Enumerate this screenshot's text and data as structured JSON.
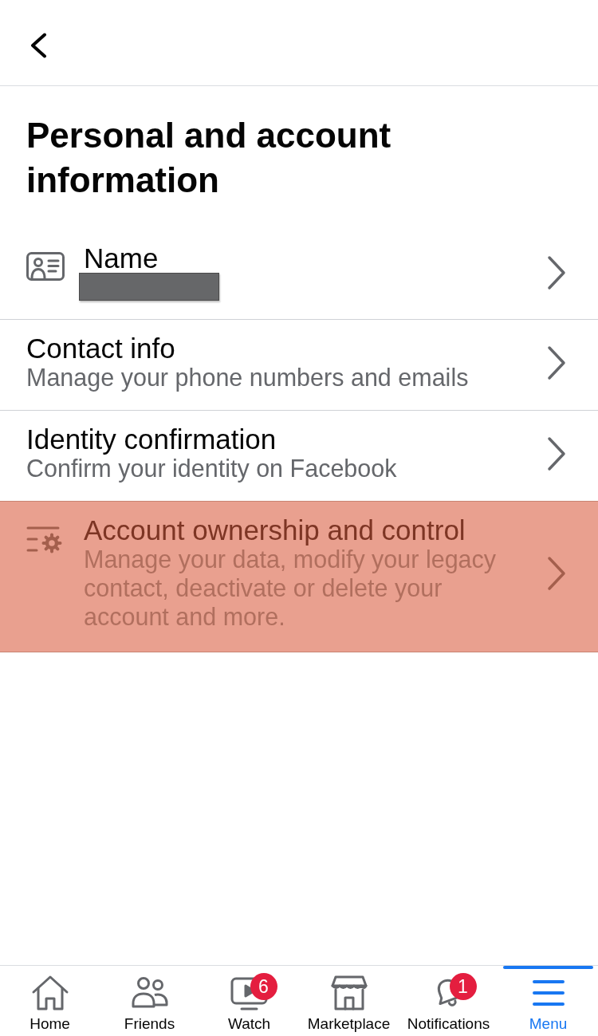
{
  "title": "Personal and account information",
  "items": [
    {
      "kind": "name",
      "title": "Name",
      "redacted": true,
      "highlighted": false
    },
    {
      "kind": "detail",
      "title": "Contact info",
      "subtitle": "Manage your phone numbers and emails",
      "highlighted": false
    },
    {
      "kind": "detail",
      "title": "Identity confirmation",
      "subtitle": "Confirm your identity on Facebook",
      "highlighted": false
    },
    {
      "kind": "ownership",
      "title": "Account ownership and control",
      "subtitle": "Manage your data, modify your legacy contact, deactivate or delete your account and more.",
      "highlighted": true
    }
  ],
  "tab_bar": [
    {
      "label": "Home",
      "selected": false
    },
    {
      "label": "Friends",
      "selected": false
    },
    {
      "label": "Watch",
      "badge": "6",
      "selected": false
    },
    {
      "label": "Marketplace",
      "selected": false
    },
    {
      "label": "Notifications",
      "badge": "1",
      "selected": false
    },
    {
      "label": "Menu",
      "selected": true
    }
  ]
}
